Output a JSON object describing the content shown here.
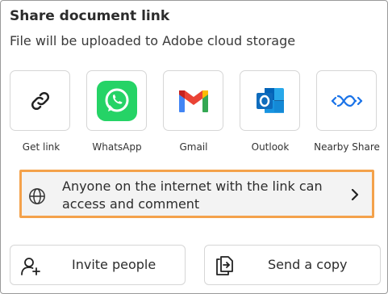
{
  "dialog": {
    "title": "Share document link",
    "subtitle": "File will be uploaded to Adobe cloud storage"
  },
  "share_targets": [
    {
      "label": "Get link",
      "icon": "link-icon"
    },
    {
      "label": "WhatsApp",
      "icon": "whatsapp-icon",
      "color": "#25d366"
    },
    {
      "label": "Gmail",
      "icon": "gmail-icon"
    },
    {
      "label": "Outlook",
      "icon": "outlook-icon",
      "color": "#0f6cbd"
    },
    {
      "label": "Nearby Share",
      "icon": "nearby-share-icon",
      "color": "#1a73e8"
    }
  ],
  "access": {
    "text": "Anyone on the internet with the link can access and comment",
    "icon": "globe-icon",
    "highlight_color": "#f4a24b"
  },
  "actions": {
    "invite_label": "Invite people",
    "send_copy_label": "Send a copy"
  }
}
